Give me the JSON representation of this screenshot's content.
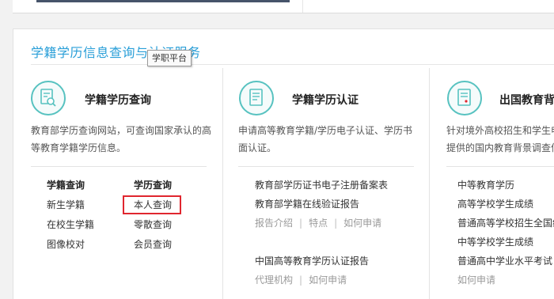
{
  "section_title": "学籍学历信息查询与认证服务",
  "tooltip": "学职平台",
  "cards": [
    {
      "title": "学籍学历查询",
      "icon": "search-document-icon",
      "description": "教育部学历查询网站，可查询国家承认的高等教育学籍学历信息。",
      "columns": [
        {
          "heading": "学籍查询",
          "items": [
            "新生学籍",
            "在校生学籍",
            "图像校对"
          ]
        },
        {
          "heading": "学历查询",
          "items": [
            "本人查询",
            "零散查询",
            "会员查询"
          ]
        }
      ]
    },
    {
      "title": "学籍学历认证",
      "icon": "certificate-document-icon",
      "description": "申请高等教育学籍/学历电子认证、学历书面认证。",
      "links": {
        "registry_filing": "教育部学历证书电子注册备案表",
        "online_report": "教育部学籍在线验证报告",
        "report_intro": "报告介绍",
        "features": "特点",
        "how_to_apply": "如何申请",
        "china_report": "中国高等教育学历认证报告",
        "agency": "代理机构",
        "how_to_apply_2": "如何申请"
      }
    },
    {
      "title": "出国教育背",
      "icon": "report-document-icon",
      "description_lines": [
        "针对境外高校招生和学生申",
        "提供的国内教育背景调查信"
      ],
      "items": [
        "中等教育学历",
        "高等学校学生成绩",
        "普通高等学校招生全国统",
        "中等学校学生成绩",
        "普通高中学业水平考试",
        "如何申请"
      ]
    }
  ],
  "highlighted_item": "本人查询",
  "colors": {
    "accent_blue": "#2a9fd8",
    "icon_teal": "#57c2c0",
    "highlight_red": "#e0262f",
    "muted_text": "#9a9a9a"
  }
}
